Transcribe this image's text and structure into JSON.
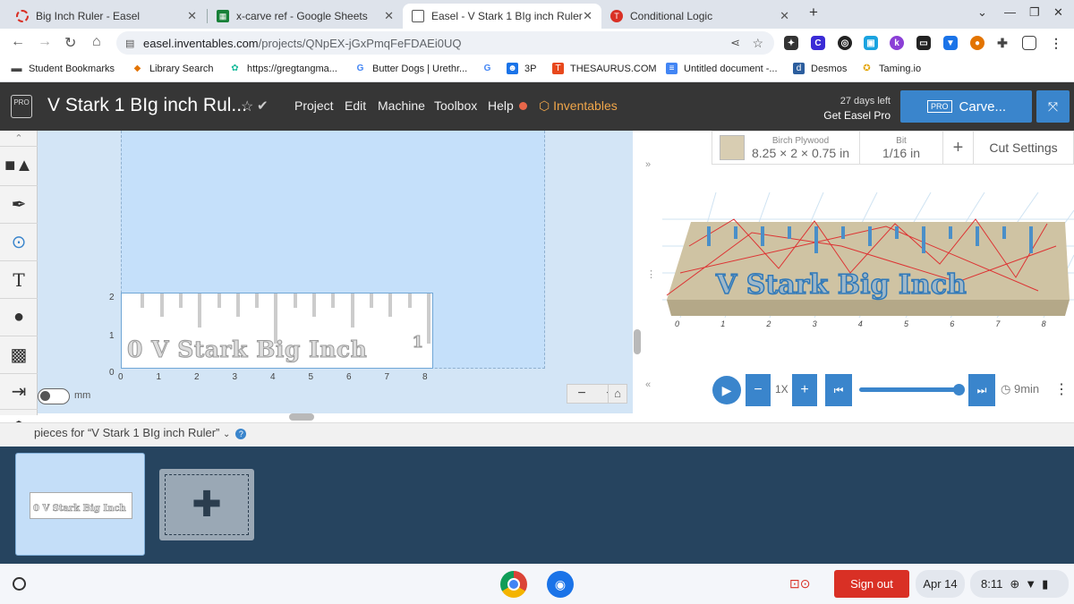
{
  "browser": {
    "tabs": [
      {
        "title": "Big Inch Ruler - Easel",
        "icon": "easel-icon"
      },
      {
        "title": "x-carve ref - Google Sheets",
        "icon": "sheets-icon"
      },
      {
        "title": "Easel - V Stark 1 BIg inch Ruler",
        "icon": "easel-icon"
      },
      {
        "title": "Conditional Logic",
        "icon": "t-icon"
      }
    ],
    "active_tab": 2,
    "new_tab_label": "+",
    "url_host": "easel.inventables.com",
    "url_path": "/projects/QNpEX-jGxPmqFeFDAEi0UQ",
    "bookmarks": [
      {
        "label": "Student Bookmarks",
        "icon": "folder-icon"
      },
      {
        "label": "Library Search",
        "icon": "diamond-icon"
      },
      {
        "label": "https://gregtangma...",
        "icon": "puzzle-icon"
      },
      {
        "label": "Butter Dogs | Urethr...",
        "icon": "google-icon"
      },
      {
        "label": "",
        "icon": "google-icon"
      },
      {
        "label": "3P",
        "icon": "person-icon"
      },
      {
        "label": "THESAURUS.COM",
        "icon": "thesaurus-icon"
      },
      {
        "label": "Untitled document -...",
        "icon": "docs-icon"
      },
      {
        "label": "Desmos",
        "icon": "desmos-icon"
      },
      {
        "label": "Taming.io",
        "icon": "taming-icon"
      }
    ]
  },
  "easel": {
    "pro_logo": "PRO",
    "project_title": "V Stark 1 BIg inch Rul...",
    "menu": [
      "Project",
      "Edit",
      "Machine",
      "Toolbox",
      "Help"
    ],
    "inventables_label": "Inventables",
    "trial_days": "27 days left",
    "trial_cta": "Get Easel Pro",
    "carve_pro": "PRO",
    "carve_label": "Carve...",
    "canvas": {
      "x_ticks": [
        "0",
        "1",
        "2",
        "3",
        "4",
        "5",
        "6",
        "7",
        "8"
      ],
      "y_ticks": [
        "0",
        "1",
        "2"
      ],
      "ruler_text": "0  V Stark Big Inch",
      "ruler_one": "1",
      "mm_label": "mm",
      "zoom_minus": "−",
      "zoom_plus": "+"
    },
    "material": {
      "name": "Birch Plywood",
      "dims": "8.25 × 2 × 0.75 in"
    },
    "bit": {
      "label": "Bit",
      "value": "1/16 in"
    },
    "add_label": "+",
    "cut_settings": "Cut Settings",
    "preview_x_ticks": [
      "0",
      "1",
      "2",
      "3",
      "4",
      "5",
      "6",
      "7",
      "8"
    ],
    "preview_text": "V Stark Big Inch",
    "playback": {
      "speed": "1X",
      "time": "9min"
    },
    "pieces_label": "pieces for “V Stark 1 BIg inch Ruler”",
    "thumb_text": "0 V Stark Big Inch"
  },
  "shelf": {
    "sign_out": "Sign out",
    "date": "Apr 14",
    "time": "8:11"
  },
  "colors": {
    "accent": "#3a85cc",
    "header": "#363636",
    "tray": "#26445f",
    "signout": "#d93025"
  }
}
